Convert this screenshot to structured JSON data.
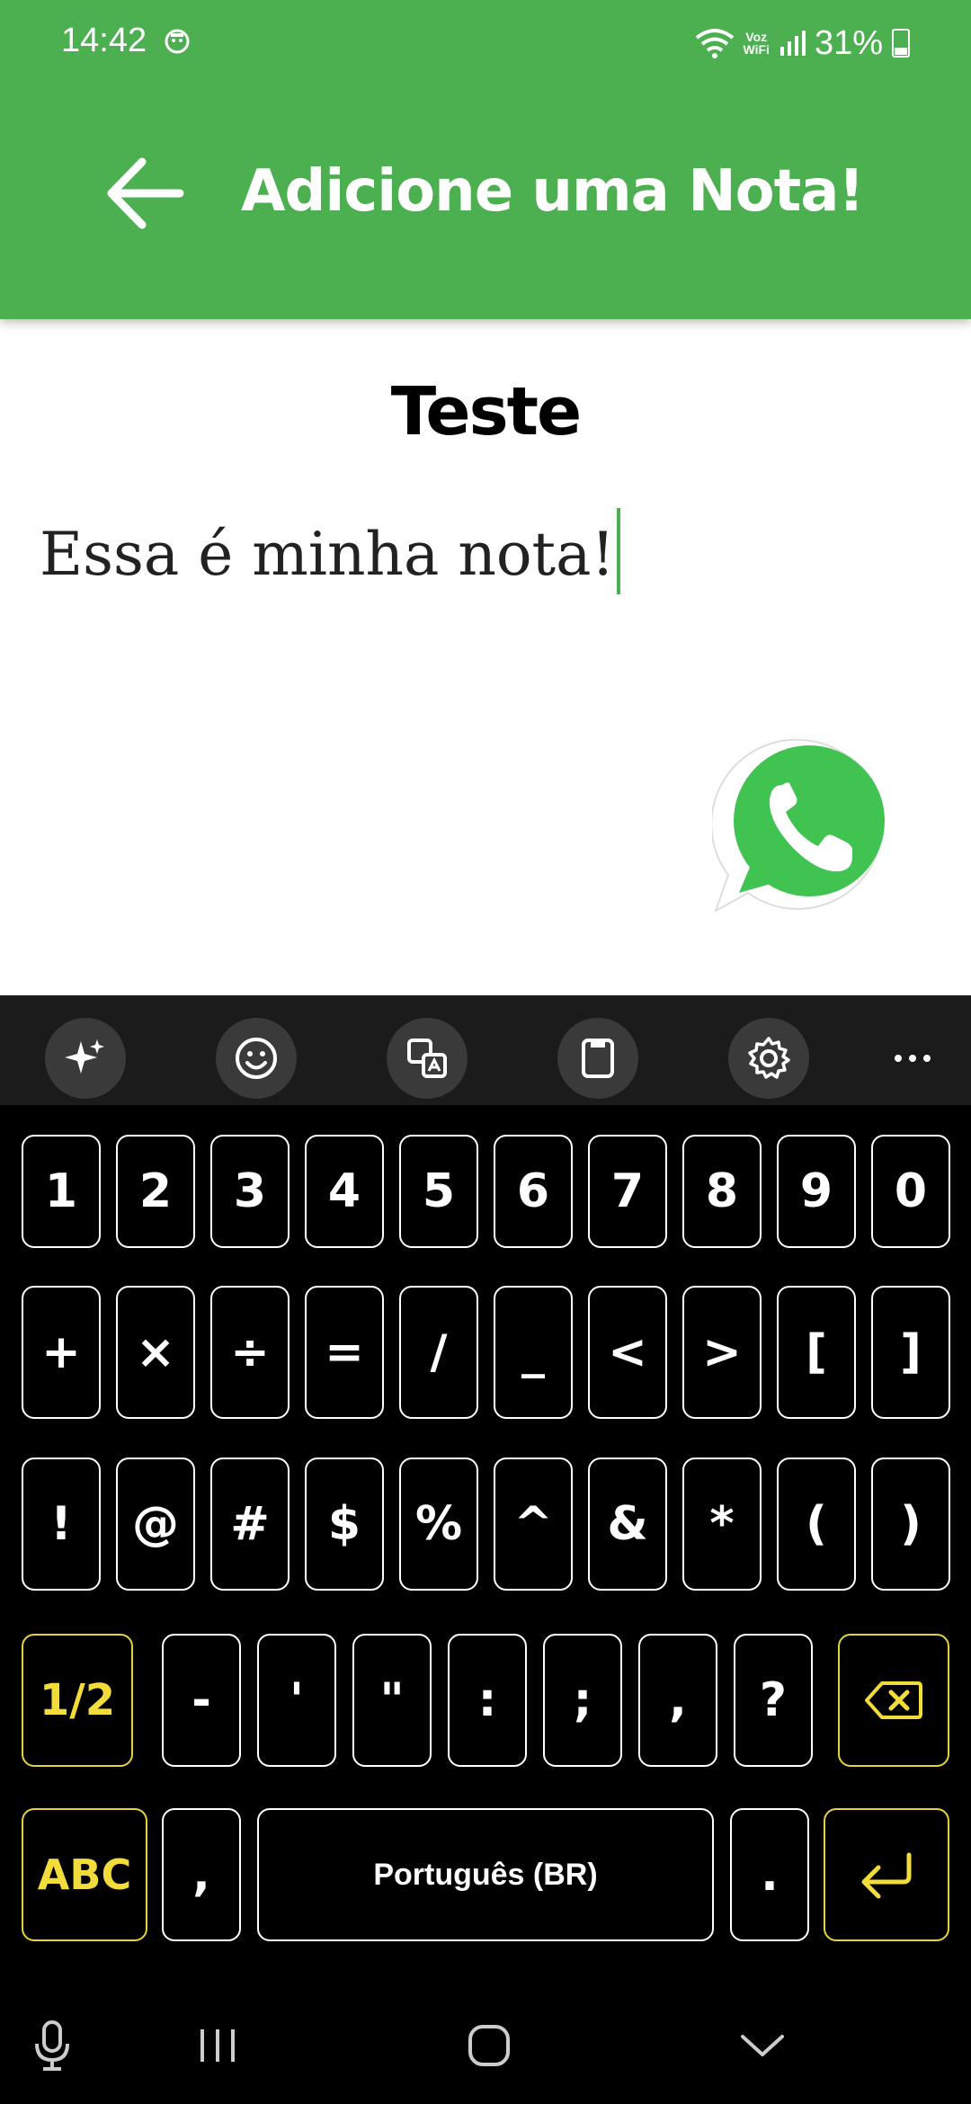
{
  "status": {
    "time": "14:42",
    "voz_line1": "Voz",
    "voz_line2": "WiFi",
    "battery": "31%"
  },
  "header": {
    "title": "Adicione uma Nota!"
  },
  "note": {
    "title": "Teste",
    "body": "Essa é minha nota!"
  },
  "keyboard": {
    "row1": [
      "1",
      "2",
      "3",
      "4",
      "5",
      "6",
      "7",
      "8",
      "9",
      "0"
    ],
    "row2": [
      "+",
      "×",
      "÷",
      "=",
      "/",
      "_",
      "<",
      ">",
      "[",
      "]"
    ],
    "row3": [
      "!",
      "@",
      "#",
      "$",
      "%",
      "^",
      "&",
      "*",
      "(",
      ")"
    ],
    "row4_shift": "1/2",
    "row4": [
      "-",
      "'",
      "\"",
      ":",
      ";",
      ",",
      "?"
    ],
    "abc": "ABC",
    "comma": ",",
    "space": "Português (BR)",
    "period": "."
  },
  "colors": {
    "appbar": "#4caf50",
    "accent_yellow": "#f2dc3c"
  }
}
